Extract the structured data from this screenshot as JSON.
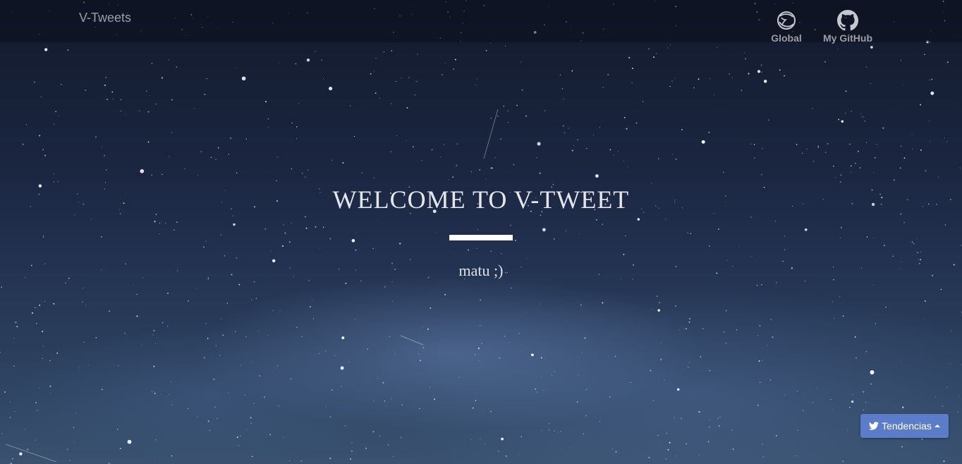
{
  "navbar": {
    "brand": "V-Tweets",
    "items": [
      {
        "label": "Global",
        "icon": "globe-icon"
      },
      {
        "label": "My GitHub",
        "icon": "github-icon"
      }
    ]
  },
  "hero": {
    "title": "WELCOME TO V-TWEET",
    "subtitle": "matu ;)"
  },
  "trends_button": {
    "label": "Tendencias",
    "icon": "twitter-bird-icon",
    "caret_icon": "caret-up-icon",
    "background_color": "#5b7cc9"
  },
  "background": {
    "description_icon": "starry-sky-background"
  }
}
